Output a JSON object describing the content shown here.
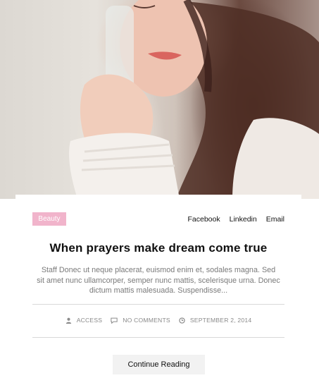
{
  "hero": {
    "image_alt": "woman holding glass bottle"
  },
  "post": {
    "category": "Beauty",
    "share": [
      "Facebook",
      "Linkedin",
      "Email"
    ],
    "title": "When prayers make dream come true",
    "excerpt": "Staff Donec ut neque placerat, euismod enim et, sodales magna. Sed sit amet nunc ullamcorper, semper nunc mattis, scelerisque urna. Donec dictum mattis malesuada. Suspendisse...",
    "meta": {
      "author": "ACCESS",
      "comments": "NO COMMENTS",
      "date": "SEPTEMBER 2, 2014"
    },
    "cta": "Continue Reading"
  },
  "colors": {
    "badge_bg": "#f1b4cb",
    "text_dark": "#111111",
    "text_muted": "#7a7a7a",
    "button_bg": "#f2f2f2"
  }
}
